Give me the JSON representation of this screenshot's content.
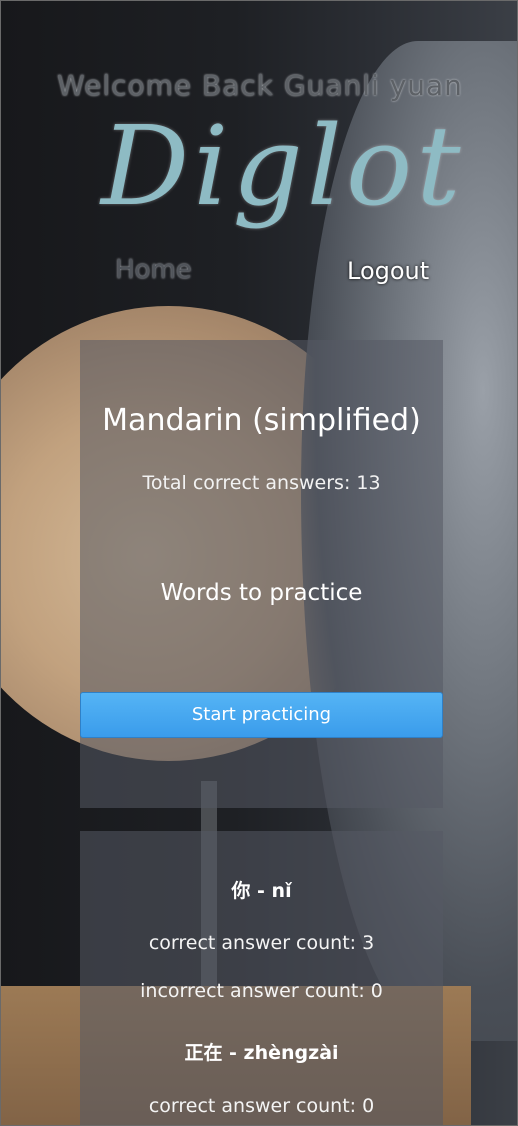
{
  "header": {
    "welcome": "Welcome Back Guanli yuan",
    "logo": "Diglot"
  },
  "nav": {
    "home": "Home",
    "logout": "Logout"
  },
  "summary": {
    "language": "Mandarin (simplified)",
    "total_correct": "Total correct answers: 13",
    "practice_heading": "Words to practice",
    "start_button": "Start practicing"
  },
  "words": [
    {
      "title": "你 - nǐ",
      "correct": "correct answer count: 3",
      "incorrect": "incorrect answer count: 0"
    },
    {
      "title": "正在 - zhèngzài",
      "correct": "correct answer count: 0"
    }
  ],
  "colors": {
    "logo": "#8ebbc4",
    "button": "#3a9ceb",
    "panel": "#555a64"
  }
}
